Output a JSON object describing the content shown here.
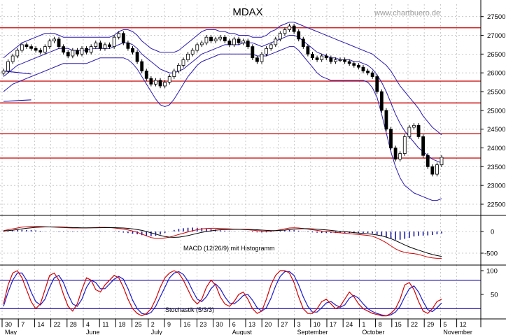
{
  "chart_data": [
    {
      "type": "candlestick",
      "title": "MDAX",
      "watermark": "www.chartbuero.de",
      "y_axis": {
        "ylim": [
          22000,
          27800
        ],
        "ticks": [
          22500,
          23000,
          23500,
          24000,
          24500,
          25000,
          25500,
          26000,
          26500,
          27000,
          27500
        ]
      },
      "horizontal_levels": [
        27200,
        25780,
        25200,
        24380,
        23730
      ],
      "series": [
        {
          "role": "close",
          "values": [
            26050,
            26300,
            26450,
            26600,
            26750,
            26700,
            26650,
            26600,
            26550,
            26700,
            26850,
            26900,
            26700,
            26550,
            26450,
            26600,
            26500,
            26650,
            26550,
            26700,
            26800,
            26650,
            26750,
            26700,
            26950,
            27050,
            26800,
            26650,
            26550,
            26300,
            26050,
            25850,
            25700,
            25800,
            25650,
            25750,
            25900,
            26050,
            26200,
            26350,
            26500,
            26600,
            26750,
            26800,
            26950,
            26850,
            26900,
            26950,
            26850,
            26750,
            26900,
            26800,
            26850,
            26700,
            26400,
            26300,
            26500,
            26650,
            26750,
            26900,
            27050,
            27150,
            27250,
            27100,
            26900,
            26700,
            26500,
            26400,
            26350,
            26450,
            26400,
            26300,
            26350,
            26350,
            26300,
            26250,
            26200,
            26150,
            26050,
            26000,
            25900,
            25500,
            25000,
            24500,
            24000,
            23700,
            23850,
            24300,
            24550,
            24600,
            24300,
            23800,
            23500,
            23300,
            23550,
            23750
          ]
        },
        {
          "role": "upper_band",
          "values": [
            26400,
            26500,
            26600,
            26700,
            26800,
            26850,
            26900,
            26950,
            27000,
            27050,
            27050,
            27050,
            27000,
            26950,
            26950,
            26950,
            26950,
            26950,
            26950,
            26950,
            26950,
            26950,
            26950,
            26950,
            27000,
            27100,
            27150,
            27150,
            27100,
            27000,
            26850,
            26750,
            26650,
            26600,
            26550,
            26550,
            26550,
            26550,
            26600,
            26700,
            26800,
            26900,
            27000,
            27100,
            27150,
            27150,
            27150,
            27100,
            27100,
            27050,
            27050,
            27000,
            27000,
            27000,
            26950,
            26950,
            26950,
            27000,
            27100,
            27150,
            27250,
            27300,
            27350,
            27350,
            27300,
            27250,
            27200,
            27150,
            27100,
            27050,
            27000,
            26950,
            26900,
            26850,
            26800,
            26750,
            26700,
            26650,
            26600,
            26550,
            26500,
            26400,
            26300,
            26200,
            26050,
            25850,
            25650,
            25500,
            25350,
            25200,
            25050,
            24850,
            24700,
            24550,
            24450,
            24350
          ]
        },
        {
          "role": "middle_band",
          "values": [
            25900,
            26000,
            26100,
            26200,
            26250,
            26300,
            26350,
            26400,
            26450,
            26500,
            26550,
            26600,
            26650,
            26650,
            26650,
            26600,
            26600,
            26600,
            26600,
            26650,
            26650,
            26650,
            26650,
            26650,
            26700,
            26750,
            26800,
            26800,
            26750,
            26650,
            26500,
            26400,
            26300,
            26200,
            26100,
            26050,
            26000,
            26000,
            26050,
            26100,
            26200,
            26300,
            26400,
            26500,
            26550,
            26600,
            26650,
            26700,
            26750,
            26750,
            26750,
            26750,
            26800,
            26800,
            26800,
            26750,
            26700,
            26750,
            26800,
            26850,
            26900,
            26950,
            27000,
            27000,
            26950,
            26850,
            26750,
            26650,
            26550,
            26500,
            26450,
            26400,
            26400,
            26350,
            26350,
            26350,
            26300,
            26300,
            26250,
            26200,
            26100,
            25950,
            25750,
            25500,
            25200,
            24900,
            24650,
            24450,
            24300,
            24150,
            24000,
            23900,
            23800,
            23700,
            23650,
            23600
          ]
        },
        {
          "role": "lower_band",
          "values": [
            25500,
            25600,
            25700,
            25750,
            25800,
            25850,
            25900,
            25950,
            26000,
            26050,
            26100,
            26150,
            26200,
            26250,
            26250,
            26250,
            26250,
            26250,
            26250,
            26300,
            26350,
            26400,
            26400,
            26400,
            26400,
            26400,
            26400,
            26350,
            26250,
            26100,
            25900,
            25700,
            25500,
            25300,
            25150,
            25100,
            25150,
            25300,
            25500,
            25700,
            25900,
            26050,
            26200,
            26300,
            26350,
            26400,
            26450,
            26500,
            26500,
            26500,
            26500,
            26500,
            26500,
            26500,
            26500,
            26450,
            26450,
            26450,
            26500,
            26550,
            26600,
            26650,
            26700,
            26700,
            26600,
            26450,
            26300,
            26150,
            26000,
            25900,
            25850,
            25800,
            25800,
            25800,
            25800,
            25800,
            25800,
            25800,
            25800,
            25750,
            25600,
            25350,
            24900,
            24400,
            23900,
            23500,
            23200,
            23000,
            22900,
            22800,
            22750,
            22700,
            22650,
            22600,
            22600,
            22650
          ]
        },
        {
          "role": "support_line_blue",
          "values": [
            [
              0,
              26050
            ],
            [
              6,
              25970
            ]
          ]
        },
        {
          "role": "support_line_blue",
          "values": [
            [
              0,
              25240
            ],
            [
              6,
              25280
            ]
          ]
        }
      ],
      "x_axis": {
        "tick_labels": [
          "30",
          "7",
          "14",
          "22",
          "28",
          "4",
          "11",
          "18",
          "25",
          "2",
          "9",
          "16",
          "23",
          "30",
          "6",
          "13",
          "20",
          "27",
          "3",
          "10",
          "17",
          "24",
          "1",
          "8",
          "15",
          "22",
          "29",
          "5",
          "12"
        ],
        "month_labels": [
          "May",
          "June",
          "July",
          "August",
          "September",
          "October",
          "November"
        ]
      }
    },
    {
      "type": "line",
      "label": "MACD (12/26/9) mit Histogramm",
      "y_axis": {
        "ticks": [
          0,
          -500
        ]
      },
      "series": [
        {
          "role": "macd",
          "values": [
            20,
            40,
            60,
            80,
            100,
            110,
            120,
            120,
            115,
            110,
            105,
            100,
            95,
            90,
            85,
            80,
            80,
            80,
            80,
            85,
            90,
            95,
            95,
            90,
            80,
            70,
            55,
            35,
            10,
            -20,
            -60,
            -100,
            -140,
            -160,
            -160,
            -150,
            -130,
            -100,
            -70,
            -40,
            -10,
            20,
            40,
            60,
            70,
            75,
            75,
            70,
            65,
            60,
            55,
            50,
            45,
            40,
            30,
            20,
            10,
            5,
            10,
            20,
            40,
            60,
            80,
            85,
            80,
            70,
            55,
            40,
            25,
            10,
            0,
            -10,
            -20,
            -30,
            -40,
            -50,
            -60,
            -70,
            -80,
            -90,
            -110,
            -150,
            -200,
            -260,
            -330,
            -400,
            -450,
            -480,
            -500,
            -510,
            -530,
            -560,
            -590,
            -610,
            -620,
            -620
          ]
        },
        {
          "role": "signal",
          "values": [
            10,
            20,
            30,
            45,
            60,
            75,
            85,
            95,
            100,
            105,
            105,
            105,
            105,
            100,
            95,
            90,
            88,
            86,
            84,
            84,
            85,
            87,
            89,
            90,
            88,
            85,
            80,
            72,
            60,
            45,
            25,
            0,
            -30,
            -60,
            -90,
            -115,
            -130,
            -135,
            -130,
            -115,
            -95,
            -70,
            -45,
            -20,
            0,
            15,
            30,
            40,
            45,
            48,
            50,
            50,
            50,
            48,
            45,
            40,
            33,
            25,
            20,
            20,
            25,
            33,
            45,
            55,
            62,
            66,
            65,
            60,
            53,
            45,
            35,
            25,
            15,
            5,
            -5,
            -15,
            -25,
            -35,
            -45,
            -55,
            -65,
            -80,
            -100,
            -130,
            -165,
            -210,
            -260,
            -310,
            -355,
            -395,
            -430,
            -465,
            -500,
            -530,
            -555,
            -575
          ]
        },
        {
          "role": "histogram",
          "values": [
            10,
            20,
            30,
            35,
            40,
            35,
            35,
            25,
            15,
            5,
            0,
            -5,
            -10,
            -10,
            -10,
            -10,
            -8,
            -6,
            -4,
            1,
            5,
            8,
            6,
            0,
            -8,
            -15,
            -25,
            -37,
            -50,
            -65,
            -85,
            -100,
            -110,
            -100,
            -70,
            -35,
            0,
            35,
            60,
            75,
            85,
            90,
            85,
            80,
            70,
            60,
            45,
            30,
            20,
            12,
            5,
            0,
            -5,
            -8,
            -15,
            -20,
            -23,
            -20,
            -10,
            0,
            15,
            27,
            35,
            30,
            18,
            4,
            -10,
            -20,
            -28,
            -35,
            -35,
            -35,
            -35,
            -35,
            -35,
            -35,
            -35,
            -35,
            -35,
            -35,
            -45,
            -70,
            -100,
            -130,
            -165,
            -190,
            -190,
            -170,
            -145,
            -115,
            -100,
            -95,
            -90,
            -80,
            -65,
            -45
          ]
        }
      ]
    },
    {
      "type": "line",
      "label": "Stochastik (5/3/3)",
      "y_axis": {
        "ticks": [
          100,
          50
        ],
        "ylim": [
          0,
          110
        ],
        "levels": [
          80,
          20
        ]
      },
      "series": [
        {
          "role": "k",
          "values": [
            30,
            70,
            95,
            100,
            85,
            60,
            35,
            20,
            30,
            60,
            90,
            95,
            80,
            50,
            25,
            15,
            30,
            60,
            85,
            80,
            60,
            55,
            70,
            80,
            90,
            85,
            65,
            40,
            20,
            10,
            5,
            10,
            20,
            40,
            65,
            85,
            95,
            100,
            95,
            80,
            60,
            40,
            30,
            40,
            65,
            80,
            70,
            45,
            30,
            25,
            35,
            50,
            55,
            40,
            20,
            10,
            15,
            40,
            70,
            90,
            100,
            100,
            95,
            75,
            45,
            20,
            10,
            10,
            20,
            35,
            40,
            30,
            20,
            25,
            40,
            55,
            45,
            30,
            20,
            15,
            10,
            8,
            5,
            5,
            10,
            20,
            40,
            70,
            75,
            60,
            35,
            15,
            10,
            20,
            35,
            40
          ]
        },
        {
          "role": "d",
          "values": [
            25,
            55,
            80,
            95,
            95,
            80,
            55,
            35,
            28,
            40,
            65,
            85,
            90,
            75,
            50,
            30,
            25,
            40,
            65,
            80,
            75,
            62,
            62,
            72,
            82,
            88,
            82,
            62,
            38,
            20,
            10,
            8,
            12,
            25,
            45,
            65,
            85,
            95,
            98,
            92,
            78,
            58,
            40,
            35,
            45,
            62,
            72,
            62,
            45,
            32,
            30,
            38,
            48,
            50,
            38,
            22,
            15,
            22,
            42,
            68,
            88,
            98,
            98,
            90,
            70,
            45,
            25,
            13,
            13,
            22,
            32,
            35,
            28,
            23,
            28,
            42,
            48,
            42,
            30,
            20,
            14,
            10,
            7,
            5,
            7,
            13,
            25,
            45,
            62,
            68,
            55,
            35,
            18,
            14,
            22,
            32
          ]
        }
      ]
    }
  ]
}
